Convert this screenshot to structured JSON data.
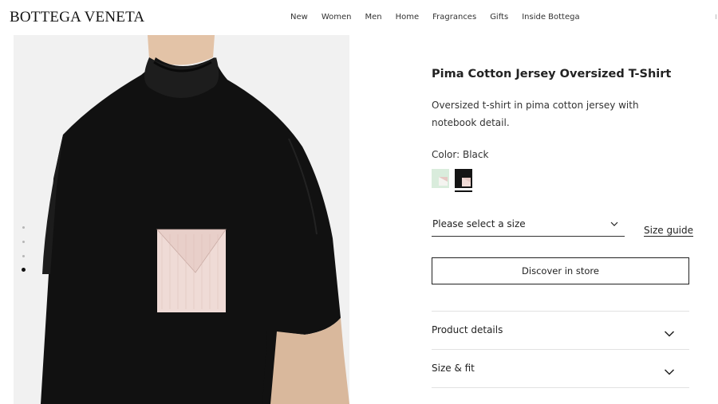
{
  "header": {
    "logo": "BOTTEGA VENETA",
    "nav": [
      "New",
      "Women",
      "Men",
      "Home",
      "Fragrances",
      "Gifts",
      "Inside Bottega"
    ]
  },
  "gallery": {
    "image_description_icon": "tshirt-model-image",
    "dots_count": 4,
    "active_dot": 4
  },
  "product": {
    "title": "Pima Cotton Jersey Oversized T-Shirt",
    "description": "Oversized t-shirt in pima cotton jersey with notebook detail.",
    "color_label": "Color: Black",
    "swatches": [
      {
        "color": "#d9ecdc",
        "selected": false
      },
      {
        "color": "#151515",
        "selected": true
      }
    ],
    "size_placeholder": "Please select a size",
    "size_guide": "Size guide",
    "store_button": "Discover in store",
    "accordions": [
      {
        "label": "Product details"
      },
      {
        "label": "Size & fit"
      }
    ]
  }
}
